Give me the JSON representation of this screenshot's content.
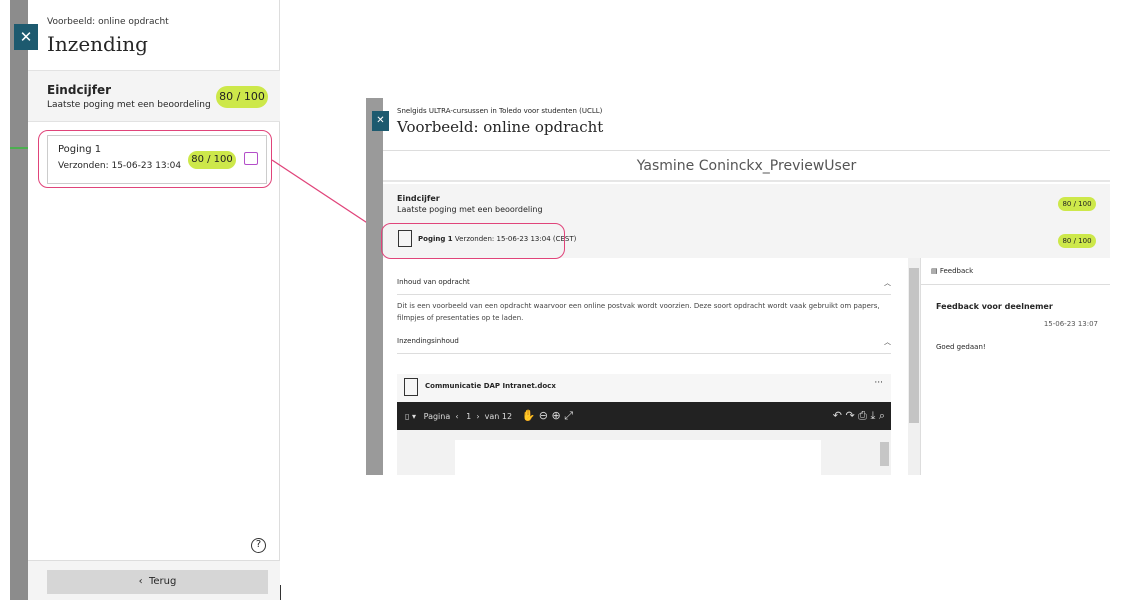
{
  "left_panel": {
    "breadcrumb": "Voorbeeld: online opdracht",
    "title": "Inzending",
    "final_grade": {
      "label": "Eindcijfer",
      "sub": "Laatste poging met een beoordeling",
      "score": "80 / 100"
    },
    "attempt": {
      "label": "Poging 1",
      "submitted": "Verzonden: 15-06-23 13:04",
      "score": "80 / 100"
    },
    "back_label": "Terug"
  },
  "right_panel": {
    "breadcrumb": "Snelgids ULTRA-cursussen in Toledo voor studenten (UCLL)",
    "title": "Voorbeeld: online opdracht",
    "student": "Yasmine Coninckx_PreviewUser",
    "final_grade": {
      "label": "Eindcijfer",
      "sub": "Laatste poging met een beoordeling",
      "score": "80 / 100"
    },
    "attempt": {
      "label": "Poging 1",
      "submitted": "Verzonden: 15-06-23 13:04 (CEST)",
      "score": "80 / 100"
    },
    "content_heading": "Inhoud van opdracht",
    "content_text": "Dit is een voorbeeld van een opdracht waarvoor een online postvak wordt voorzien. Deze soort opdracht wordt vaak gebruikt om papers, filmpjes of presentaties op te laden.",
    "submission_heading": "Inzendingsinhoud",
    "file_name": "Communicatie DAP Intranet.docx",
    "viewer": {
      "page_label": "Pagina",
      "page": "1",
      "of": "van 12"
    },
    "feedback": {
      "tab": "Feedback",
      "heading": "Feedback voor deelnemer",
      "date": "15-06-23 13:07",
      "text": "Goed gedaan!"
    }
  },
  "colors": {
    "accent": "#1d5a6f",
    "grade": "#cde84a",
    "highlight": "#e0447a",
    "feedback_icon": "#b44fc9"
  }
}
